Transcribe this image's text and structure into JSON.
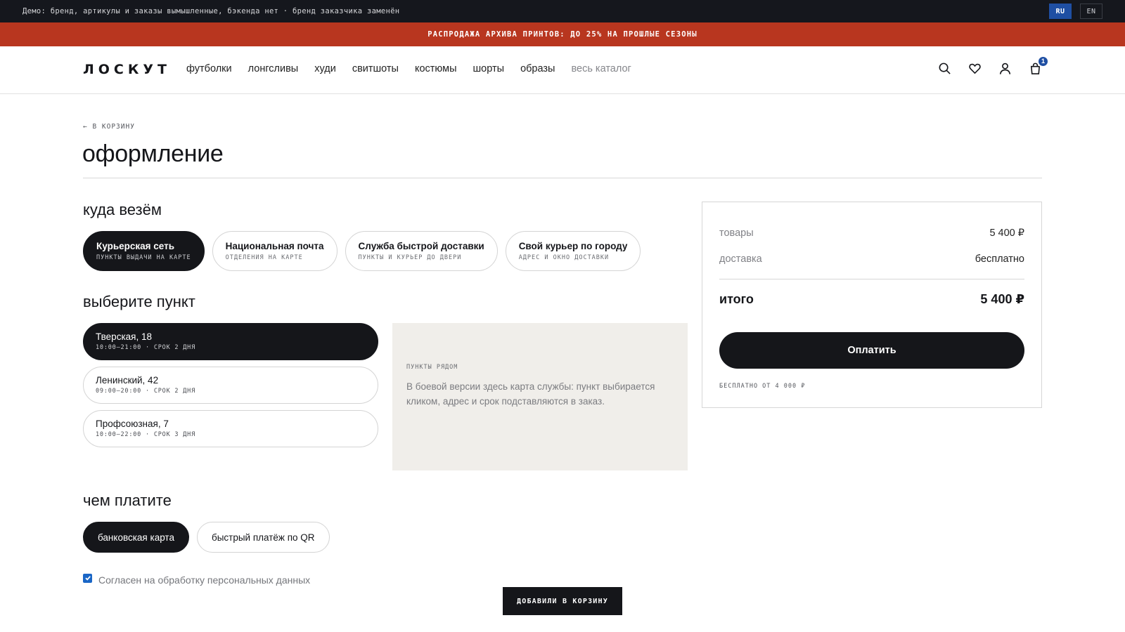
{
  "topbar": {
    "notice": "Демо: бренд, артикулы и заказы вымышленные, бэкенда нет · бренд заказчика заменён",
    "languages": [
      {
        "label": "RU",
        "active": true
      },
      {
        "label": "EN",
        "active": false
      }
    ]
  },
  "promo": {
    "text": "РАСПРОДАЖА АРХИВА ПРИНТОВ: ДО 25% НА ПРОШЛЫЕ СЕЗОНЫ",
    "color": "#b8361f"
  },
  "header": {
    "logo": "ЛОСКУТ",
    "nav": [
      {
        "label": "футболки"
      },
      {
        "label": "лонгсливы"
      },
      {
        "label": "худи"
      },
      {
        "label": "свитшоты"
      },
      {
        "label": "костюмы"
      },
      {
        "label": "шорты"
      },
      {
        "label": "образы"
      },
      {
        "label": "весь каталог"
      }
    ],
    "icons": [
      "search-icon",
      "heart-icon",
      "user-icon",
      "bag-icon"
    ],
    "cart_count": "1",
    "accent": "#1f4fa3"
  },
  "checkout": {
    "back_link": "← В КОРЗИНУ",
    "title": "оформление",
    "delivery": {
      "title": "куда везём",
      "options": [
        {
          "title": "Курьерская сеть",
          "subtitle": "ПУНКТЫ ВЫДАЧИ НА КАРТЕ",
          "active": true
        },
        {
          "title": "Национальная почта",
          "subtitle": "ОТДЕЛЕНИЯ НА КАРТЕ",
          "active": false
        },
        {
          "title": "Служба быстрой доставки",
          "subtitle": "ПУНКТЫ И КУРЬЕР ДО ДВЕРИ",
          "active": false
        },
        {
          "title": "Свой курьер по городу",
          "subtitle": "АДРЕС И ОКНО ДОСТАВКИ",
          "active": false
        }
      ]
    },
    "pickup": {
      "title": "выберите пункт",
      "points": [
        {
          "title": "Тверская, 18",
          "subtitle": "10:00–21:00 · СРОК 2 ДНЯ",
          "active": true
        },
        {
          "title": "Ленинский, 42",
          "subtitle": "09:00–20:00 · СРОК 2 ДНЯ",
          "active": false
        },
        {
          "title": "Профсоюзная, 7",
          "subtitle": "10:00–22:00 · СРОК 3 ДНЯ",
          "active": false
        }
      ],
      "map_label": "ПУНКТЫ РЯДОМ",
      "map_text": "В боевой версии здесь карта службы: пункт выбирается кликом, адрес и срок подставляются в заказ."
    },
    "payment": {
      "title": "чем платите",
      "options": [
        {
          "label": "банковская карта",
          "active": true
        },
        {
          "label": "быстрый платёж по QR",
          "active": false
        }
      ]
    },
    "consent": {
      "label": "Согласен на обработку персональных данных",
      "checked": true
    }
  },
  "summary": {
    "items_label": "товары",
    "items_value": "5 400 ₽",
    "delivery_label": "доставка",
    "delivery_value": "бесплатно",
    "total_label": "итого",
    "total_value": "5 400 ₽",
    "pay_button": "Оплатить",
    "free_note": "БЕСПЛАТНО ОТ 4 000 ₽"
  },
  "toast": {
    "text": "ДОБАВИЛИ В КОРЗИНУ"
  }
}
